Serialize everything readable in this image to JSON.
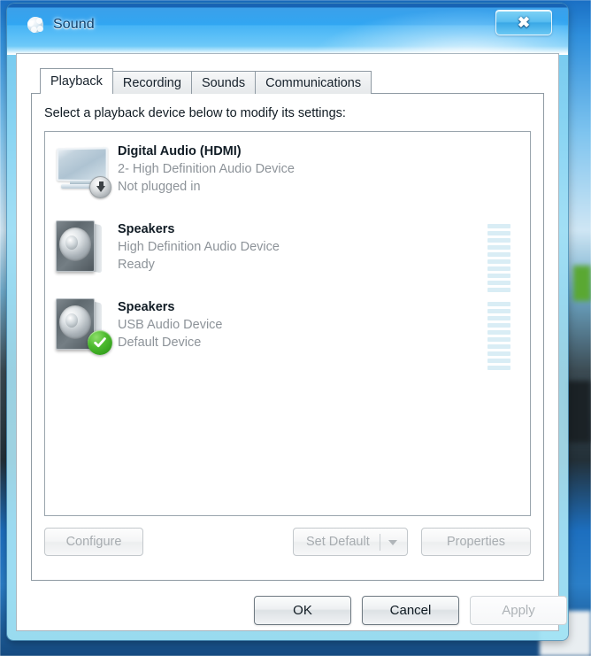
{
  "window": {
    "title": "Sound",
    "icon": "sound-speaker-icon",
    "close_label": "✕"
  },
  "tabs": [
    {
      "label": "Playback",
      "active": true
    },
    {
      "label": "Recording",
      "active": false
    },
    {
      "label": "Sounds",
      "active": false
    },
    {
      "label": "Communications",
      "active": false
    }
  ],
  "panel": {
    "instruction": "Select a playback device below to modify its settings:"
  },
  "devices": [
    {
      "name": "Digital Audio (HDMI)",
      "driver": "2- High Definition Audio Device",
      "status": "Not plugged in",
      "icon": "monitor-icon",
      "badge": "disabled-badge",
      "meter_visible": false,
      "meter_segments": 0
    },
    {
      "name": "Speakers",
      "driver": "High Definition Audio Device",
      "status": "Ready",
      "icon": "speaker-icon",
      "badge": "none",
      "meter_visible": true,
      "meter_segments": 10
    },
    {
      "name": "Speakers",
      "driver": "USB Audio Device",
      "status": "Default Device",
      "icon": "speaker-icon",
      "badge": "default-check-badge",
      "meter_visible": true,
      "meter_segments": 10
    }
  ],
  "actions": {
    "configure": "Configure",
    "set_default": "Set Default",
    "properties": "Properties"
  },
  "footer": {
    "ok": "OK",
    "cancel": "Cancel",
    "apply": "Apply"
  },
  "colors": {
    "accent": "#31a6f2",
    "default_badge": "#4cba2e",
    "meter": "#d9edf5",
    "muted_text": "#8d9399"
  }
}
